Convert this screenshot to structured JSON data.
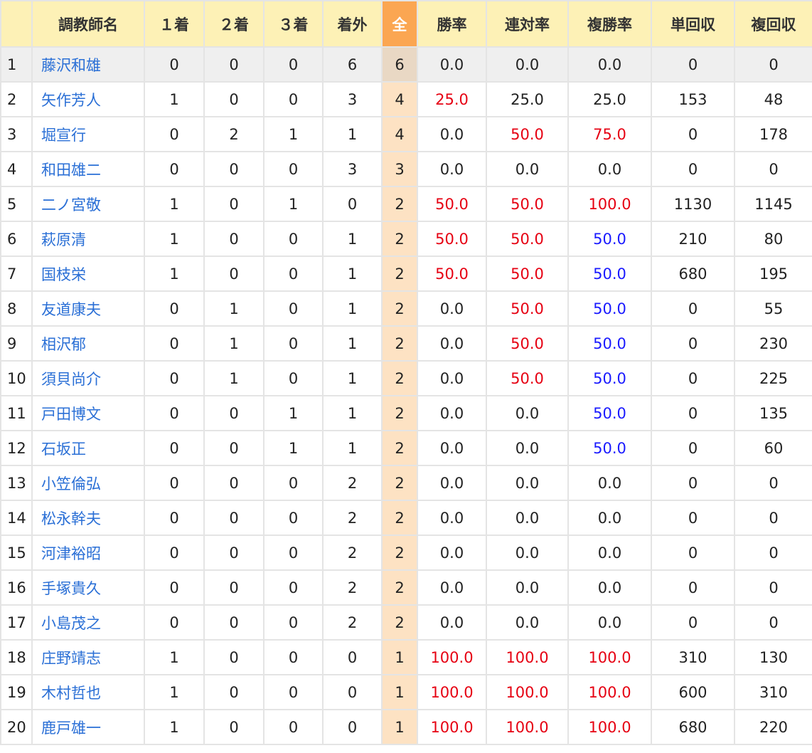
{
  "colors": {
    "header_bg": "#fdf1b6",
    "sorted_header_bg": "#fba652",
    "sorted_col_bg": "#fde2c3",
    "name_link": "#2a6fd6",
    "highlight_red": "#e60012",
    "highlight_blue": "#1a1aff"
  },
  "table": {
    "headers": {
      "rank": "",
      "name": "調教師名",
      "first": "１着",
      "second": "２着",
      "third": "３着",
      "out": "着外",
      "total": "全",
      "win_rate": "勝率",
      "quinella_rate": "連対率",
      "show_rate": "複勝率",
      "win_return": "単回収",
      "show_return": "複回収"
    },
    "rows": [
      {
        "rank": "1",
        "name": "藤沢和雄",
        "first": "0",
        "second": "0",
        "third": "0",
        "out": "6",
        "total": "6",
        "win_rate": "0.0",
        "quinella_rate": "0.0",
        "show_rate": "0.0",
        "win_return": "0",
        "show_return": "0"
      },
      {
        "rank": "2",
        "name": "矢作芳人",
        "first": "1",
        "second": "0",
        "third": "0",
        "out": "3",
        "total": "4",
        "win_rate": "25.0",
        "quinella_rate": "25.0",
        "show_rate": "25.0",
        "win_return": "153",
        "show_return": "48"
      },
      {
        "rank": "3",
        "name": "堀宣行",
        "first": "0",
        "second": "2",
        "third": "1",
        "out": "1",
        "total": "4",
        "win_rate": "0.0",
        "quinella_rate": "50.0",
        "show_rate": "75.0",
        "win_return": "0",
        "show_return": "178"
      },
      {
        "rank": "4",
        "name": "和田雄二",
        "first": "0",
        "second": "0",
        "third": "0",
        "out": "3",
        "total": "3",
        "win_rate": "0.0",
        "quinella_rate": "0.0",
        "show_rate": "0.0",
        "win_return": "0",
        "show_return": "0"
      },
      {
        "rank": "5",
        "name": "二ノ宮敬",
        "first": "1",
        "second": "0",
        "third": "1",
        "out": "0",
        "total": "2",
        "win_rate": "50.0",
        "quinella_rate": "50.0",
        "show_rate": "100.0",
        "win_return": "1130",
        "show_return": "1145"
      },
      {
        "rank": "6",
        "name": "萩原清",
        "first": "1",
        "second": "0",
        "third": "0",
        "out": "1",
        "total": "2",
        "win_rate": "50.0",
        "quinella_rate": "50.0",
        "show_rate": "50.0",
        "win_return": "210",
        "show_return": "80"
      },
      {
        "rank": "7",
        "name": "国枝栄",
        "first": "1",
        "second": "0",
        "third": "0",
        "out": "1",
        "total": "2",
        "win_rate": "50.0",
        "quinella_rate": "50.0",
        "show_rate": "50.0",
        "win_return": "680",
        "show_return": "195"
      },
      {
        "rank": "8",
        "name": "友道康夫",
        "first": "0",
        "second": "1",
        "third": "0",
        "out": "1",
        "total": "2",
        "win_rate": "0.0",
        "quinella_rate": "50.0",
        "show_rate": "50.0",
        "win_return": "0",
        "show_return": "55"
      },
      {
        "rank": "9",
        "name": "相沢郁",
        "first": "0",
        "second": "1",
        "third": "0",
        "out": "1",
        "total": "2",
        "win_rate": "0.0",
        "quinella_rate": "50.0",
        "show_rate": "50.0",
        "win_return": "0",
        "show_return": "230"
      },
      {
        "rank": "10",
        "name": "須貝尚介",
        "first": "0",
        "second": "1",
        "third": "0",
        "out": "1",
        "total": "2",
        "win_rate": "0.0",
        "quinella_rate": "50.0",
        "show_rate": "50.0",
        "win_return": "0",
        "show_return": "225"
      },
      {
        "rank": "11",
        "name": "戸田博文",
        "first": "0",
        "second": "0",
        "third": "1",
        "out": "1",
        "total": "2",
        "win_rate": "0.0",
        "quinella_rate": "0.0",
        "show_rate": "50.0",
        "win_return": "0",
        "show_return": "135"
      },
      {
        "rank": "12",
        "name": "石坂正",
        "first": "0",
        "second": "0",
        "third": "1",
        "out": "1",
        "total": "2",
        "win_rate": "0.0",
        "quinella_rate": "0.0",
        "show_rate": "50.0",
        "win_return": "0",
        "show_return": "60"
      },
      {
        "rank": "13",
        "name": "小笠倫弘",
        "first": "0",
        "second": "0",
        "third": "0",
        "out": "2",
        "total": "2",
        "win_rate": "0.0",
        "quinella_rate": "0.0",
        "show_rate": "0.0",
        "win_return": "0",
        "show_return": "0"
      },
      {
        "rank": "14",
        "name": "松永幹夫",
        "first": "0",
        "second": "0",
        "third": "0",
        "out": "2",
        "total": "2",
        "win_rate": "0.0",
        "quinella_rate": "0.0",
        "show_rate": "0.0",
        "win_return": "0",
        "show_return": "0"
      },
      {
        "rank": "15",
        "name": "河津裕昭",
        "first": "0",
        "second": "0",
        "third": "0",
        "out": "2",
        "total": "2",
        "win_rate": "0.0",
        "quinella_rate": "0.0",
        "show_rate": "0.0",
        "win_return": "0",
        "show_return": "0"
      },
      {
        "rank": "16",
        "name": "手塚貴久",
        "first": "0",
        "second": "0",
        "third": "0",
        "out": "2",
        "total": "2",
        "win_rate": "0.0",
        "quinella_rate": "0.0",
        "show_rate": "0.0",
        "win_return": "0",
        "show_return": "0"
      },
      {
        "rank": "17",
        "name": "小島茂之",
        "first": "0",
        "second": "0",
        "third": "0",
        "out": "2",
        "total": "2",
        "win_rate": "0.0",
        "quinella_rate": "0.0",
        "show_rate": "0.0",
        "win_return": "0",
        "show_return": "0"
      },
      {
        "rank": "18",
        "name": "庄野靖志",
        "first": "1",
        "second": "0",
        "third": "0",
        "out": "0",
        "total": "1",
        "win_rate": "100.0",
        "quinella_rate": "100.0",
        "show_rate": "100.0",
        "win_return": "310",
        "show_return": "130"
      },
      {
        "rank": "19",
        "name": "木村哲也",
        "first": "1",
        "second": "0",
        "third": "0",
        "out": "0",
        "total": "1",
        "win_rate": "100.0",
        "quinella_rate": "100.0",
        "show_rate": "100.0",
        "win_return": "600",
        "show_return": "310"
      },
      {
        "rank": "20",
        "name": "鹿戸雄一",
        "first": "1",
        "second": "0",
        "third": "0",
        "out": "0",
        "total": "1",
        "win_rate": "100.0",
        "quinella_rate": "100.0",
        "show_rate": "100.0",
        "win_return": "680",
        "show_return": "220"
      }
    ]
  }
}
